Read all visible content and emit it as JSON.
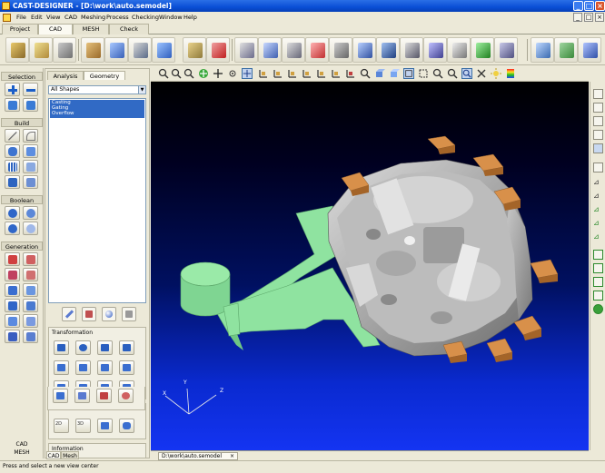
{
  "window": {
    "title": "CAST-DESIGNER - [D:\\work\\auto.semodel]",
    "controls": {
      "minimize": "_",
      "maximize": "□",
      "close": "×"
    }
  },
  "menu": {
    "items": [
      "File",
      "Edit",
      "View",
      "CAD",
      "Meshing",
      "Process",
      "Checking",
      "Window",
      "Help"
    ]
  },
  "module_tabs": [
    "Project",
    "CAD",
    "MESH",
    "Check"
  ],
  "module_tab_active": "CAD",
  "big_toolbar": {
    "icons": [
      "new-project-icon",
      "open-project-icon",
      "save-icon",
      "import-cad-icon",
      "mesh-icon",
      "modify-icon",
      "solid-icon",
      "machine-icon",
      "cooling-icon",
      "gate-icon",
      "runner-icon",
      "overflow-icon",
      "vent-icon",
      "pipe-icon",
      "valve-icon",
      "die-icon",
      "slide-icon",
      "core-icon",
      "spray-icon",
      "move-icon",
      "align-icon",
      "mirror-icon"
    ]
  },
  "left_column": {
    "selection_label": "Selection",
    "build_label": "Build",
    "boolean_label": "Boolean",
    "generation_label": "Generation",
    "footer_cad": "CAD",
    "footer_mesh": "MESH"
  },
  "shape_panel": {
    "tabs": [
      "Analysis",
      "Geometry"
    ],
    "active_tab": "Geometry",
    "filter_value": "All Shapes",
    "shapes": [
      "Casting",
      "Gating",
      "Overflow"
    ],
    "groups": {
      "transformation": "Transformation",
      "basic": "Basic",
      "information": "Information"
    },
    "basic_labels": [
      "2D",
      "3D"
    ],
    "bottom_tabs": [
      "CAD",
      "Mesh"
    ]
  },
  "view_toolbar": {
    "icons": [
      "zoom-all-icon",
      "zoom-window-icon",
      "rotate-icon",
      "zoom-in-icon",
      "pan-icon",
      "orbit-icon",
      "select-icon",
      "view-front-icon",
      "view-back-icon",
      "view-left-icon",
      "view-right-icon",
      "view-top-icon",
      "view-bottom-icon",
      "view-iso-icon",
      "zoom-box-icon",
      "shade-icon",
      "wire-icon",
      "hidden-icon",
      "fit-icon",
      "zoom-icon",
      "measure-icon",
      "section-icon",
      "light-icon",
      "color-icon"
    ]
  },
  "viewport": {
    "axes": {
      "x": "X",
      "y": "Y",
      "z": "Z"
    },
    "doc_tab": "D:\\work\\auto.semodel",
    "doc_close": "×",
    "colors": {
      "casting": "#9e9e9e",
      "gating": "#8ee09a",
      "overflow": "#c8833a"
    }
  },
  "right_toolbar": {
    "icons": [
      "view1-icon",
      "view2-icon",
      "view3-icon",
      "view4-icon",
      "view5-icon",
      "view6-icon",
      "axis1-icon",
      "axis2-icon",
      "axis3-icon",
      "axis4-icon",
      "axis5-icon",
      "export1-icon",
      "export2-icon",
      "export3-icon",
      "export4-icon",
      "globe-icon"
    ]
  },
  "status": {
    "text": "Press and select a new view center"
  }
}
